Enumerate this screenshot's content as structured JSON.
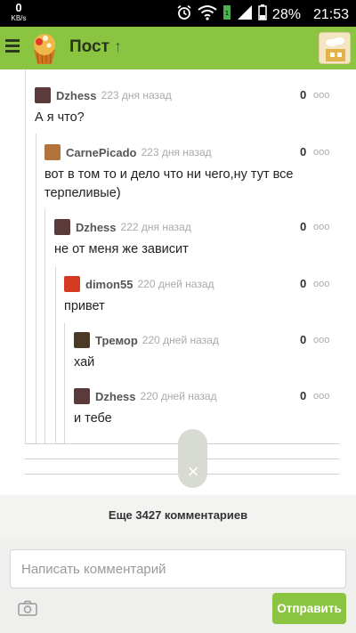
{
  "status_bar": {
    "net_speed": "0",
    "net_unit": "KB/s",
    "battery": "28%",
    "time": "21:53",
    "network": "3G"
  },
  "app_bar": {
    "title": "Пост",
    "accent": "#8ac440"
  },
  "comments": [
    {
      "user": "Dzhess",
      "time": "223 дня назад",
      "score": "0",
      "text": "А я что?",
      "avatar_color": "#5a3a3a"
    },
    {
      "user": "CarnePicado",
      "time": "223 дня назад",
      "score": "0",
      "text_lines": [
        "вот в том то и дело что ни чего,ну тут все",
        "терпеливые)"
      ],
      "avatar_color": "#b2743a"
    },
    {
      "user": "Dzhess",
      "time": "222 дня назад",
      "score": "0",
      "text": "не от меня же зависит",
      "avatar_color": "#5a3a3a"
    },
    {
      "user": "dimon55",
      "time": "220 дней назад",
      "score": "0",
      "text": "привет",
      "avatar_color": "#d43a20"
    },
    {
      "user": "Тремор",
      "time": "220 дней назад",
      "score": "0",
      "text": "хай",
      "avatar_color": "#4a3a26"
    },
    {
      "user": "Dzhess",
      "time": "220 дней назад",
      "score": "0",
      "text": "и тебе",
      "avatar_color": "#5a3a3a"
    }
  ],
  "more_comments": "Еще 3427 комментариев",
  "composer": {
    "placeholder": "Написать комментарий",
    "send_label": "Отправить"
  },
  "icons": {
    "menu": "hamburger-icon",
    "up": "arrow-up-icon",
    "more": "ooo",
    "close": "×",
    "camera": "camera-icon"
  }
}
